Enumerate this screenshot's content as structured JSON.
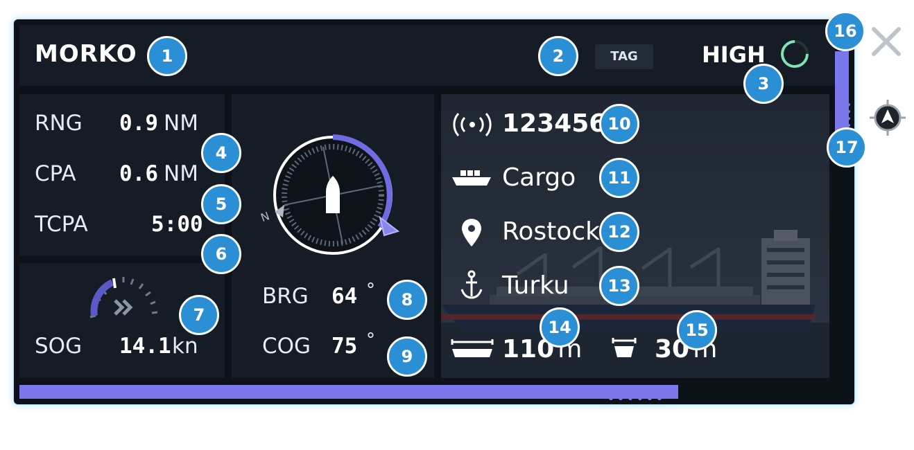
{
  "header": {
    "vessel_name": "MORKO",
    "tag_label": "TAG",
    "risk_level": "HIGH"
  },
  "metrics": {
    "rng": {
      "label": "RNG",
      "value": "0.9",
      "unit": "NM"
    },
    "cpa": {
      "label": "CPA",
      "value": "0.6",
      "unit": "NM"
    },
    "tcpa": {
      "label": "TCPA",
      "value": "5:00"
    },
    "sog": {
      "label": "SOG",
      "value": "14.1",
      "unit": "kn"
    },
    "brg": {
      "label": "BRG",
      "value": "64",
      "unit": "°"
    },
    "cog": {
      "label": "COG",
      "value": "75",
      "unit": "°"
    }
  },
  "compass": {
    "north_label": "N"
  },
  "info": {
    "mmsi": "123456",
    "type": "Cargo",
    "destination": "Rostock",
    "origin": "Turku",
    "length": {
      "value": "110",
      "unit": "m"
    },
    "beam": {
      "value": "30",
      "unit": "m"
    }
  },
  "callouts": [
    "1",
    "2",
    "3",
    "4",
    "5",
    "6",
    "7",
    "8",
    "9",
    "10",
    "11",
    "12",
    "13",
    "14",
    "15",
    "16",
    "17"
  ],
  "colors": {
    "accent": "#7a78ea",
    "callout": "#2b8fd6",
    "risk_ring": "#7fe3b4",
    "background": "#0d1118"
  },
  "icons": [
    "signal-icon",
    "cargo-ship-icon",
    "location-pin-icon",
    "anchor-icon",
    "ship-length-icon",
    "ship-beam-icon",
    "close-icon",
    "locate-target-icon",
    "speed-gauge-icon"
  ]
}
